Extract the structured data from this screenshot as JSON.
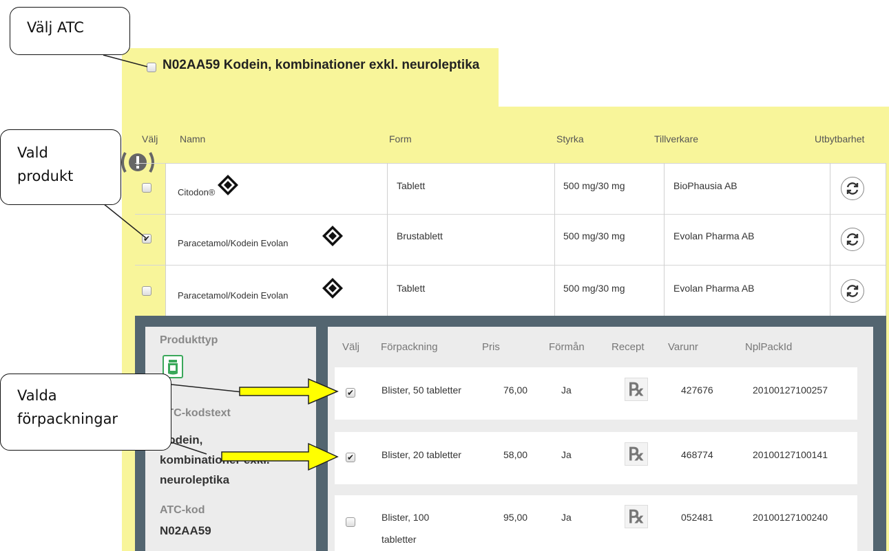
{
  "atc_group": {
    "title": "N02AA59 Kodein, kombinationer exkl. neuroleptika"
  },
  "products_table": {
    "headers": {
      "valj": "Välj",
      "namn": "Namn",
      "form": "Form",
      "styrka": "Styrka",
      "tillverkare": "Tillverkare",
      "utbytbarhet": "Utbytbarhet"
    },
    "warning_icon": "exclamation-circle-icon",
    "rows": [
      {
        "checked": false,
        "name": "Citodon®",
        "form": "Tablett",
        "strength": "500 mg/30 mg",
        "manufacturer": "BioPhausia AB"
      },
      {
        "checked": true,
        "name": "Paracetamol/Kodein Evolan",
        "form": "Brustablett",
        "strength": "500 mg/30 mg",
        "manufacturer": "Evolan Pharma AB"
      },
      {
        "checked": false,
        "name": "Paracetamol/Kodein Evolan",
        "form": "Tablett",
        "strength": "500 mg/30 mg",
        "manufacturer": "Evolan Pharma AB"
      }
    ]
  },
  "product_details": {
    "produkttyp_label": "Produkttyp",
    "produkttyp_icon": "medicine-jar-icon",
    "atc_kodstext_label": "ATC-kodstext",
    "atc_kodstext_lines": [
      "Kodein,",
      "kombinationer exkl.",
      "neuroleptika"
    ],
    "atc_kod_label": "ATC-kod",
    "atc_kod_value": "N02AA59"
  },
  "packages_table": {
    "headers": {
      "valj": "Välj",
      "forpackning": "Förpackning",
      "pris": "Pris",
      "forman": "Förmån",
      "recept": "Recept",
      "varunr": "Varunr",
      "nplpackid": "NplPackId"
    },
    "rows": [
      {
        "checked": true,
        "package_line1": "Blister, 50 tabletter",
        "package_line2": "",
        "price": "76,00",
        "benefit": "Ja",
        "rx": "℞",
        "varunr": "427676",
        "nplpackid": "20100127100257"
      },
      {
        "checked": true,
        "package_line1": "Blister, 20 tabletter",
        "package_line2": "",
        "price": "58,00",
        "benefit": "Ja",
        "rx": "℞",
        "varunr": "468774",
        "nplpackid": "20100127100141"
      },
      {
        "checked": false,
        "package_line1": "Blister, 100",
        "package_line2": "tabletter",
        "price": "95,00",
        "benefit": "Ja",
        "rx": "℞",
        "varunr": "052481",
        "nplpackid": "20100127100240"
      }
    ]
  },
  "callouts": {
    "valj_atc": "Välj ATC",
    "vald_produkt_line1": "Vald",
    "vald_produkt_line2": "produkt",
    "valda_forpackningar_line1": "Valda",
    "valda_forpackningar_line2": "förpackningar"
  },
  "colors": {
    "highlight_yellow": "#f8f59a",
    "dark_panel": "#536570",
    "arrow_fill": "#ffff00"
  }
}
